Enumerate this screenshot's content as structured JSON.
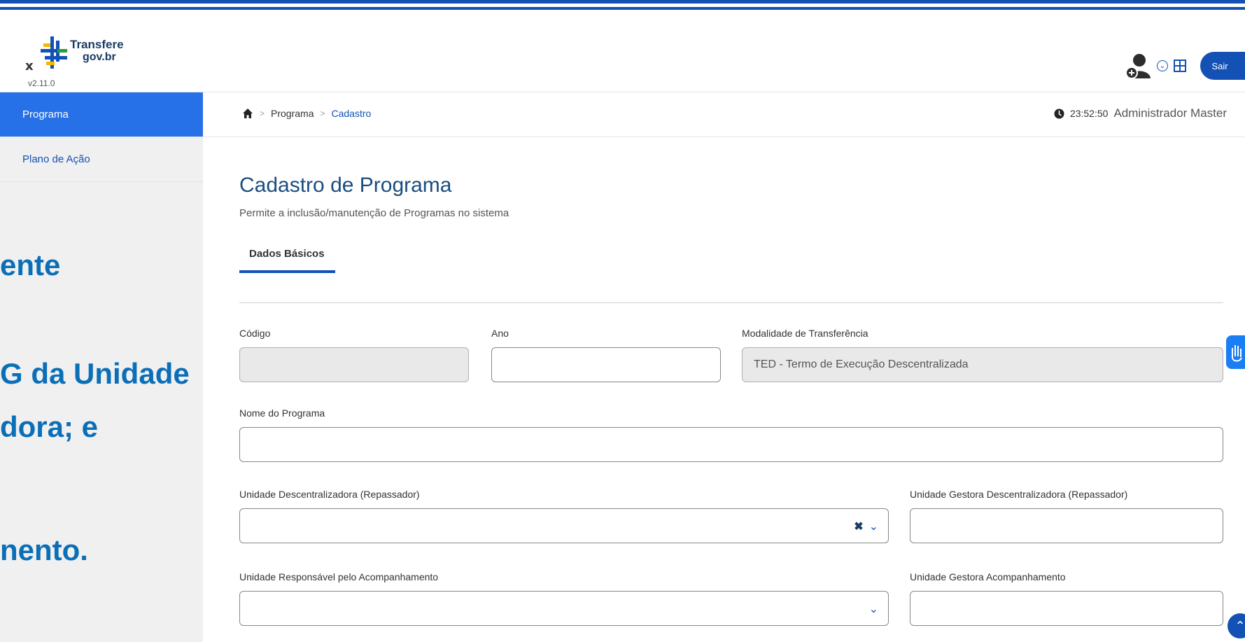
{
  "header": {
    "close_label": "x",
    "logo_line1": "Transfere",
    "logo_line2": "gov.br",
    "version": "v2.11.0",
    "sair_label": "Sair"
  },
  "sidebar": {
    "items": [
      {
        "label": "Programa"
      },
      {
        "label": "Plano de Ação"
      }
    ]
  },
  "breadcrumb": {
    "items": [
      "Programa",
      "Cadastro"
    ],
    "time": "23:52:50",
    "user": "Administrador Master"
  },
  "page": {
    "title": "Cadastro de Programa",
    "subtitle": "Permite a inclusão/manutenção de Programas no sistema",
    "tab": "Dados Básicos"
  },
  "form": {
    "codigo_label": "Código",
    "codigo_value": "",
    "ano_label": "Ano",
    "ano_value": "",
    "modalidade_label": "Modalidade de Transferência",
    "modalidade_value": "TED - Termo de Execução Descentralizada",
    "nome_label": "Nome do Programa",
    "nome_value": "",
    "unidade_desc_label": "Unidade Descentralizadora (Repassador)",
    "unidade_desc_value": "",
    "ug_desc_label": "Unidade Gestora Descentralizadora (Repassador)",
    "ug_desc_value": "",
    "unidade_resp_label": "Unidade Responsável pelo Acompanhamento",
    "unidade_resp_value": "",
    "ug_acomp_label": "Unidade Gestora Acompanhamento",
    "ug_acomp_value": ""
  },
  "overlay": {
    "line1": "ente",
    "line2": "G da Unidade",
    "line3": "dora; e",
    "line4": "nento."
  },
  "colors": {
    "primary": "#1351b4",
    "sidebar_active": "#2670e8",
    "overlay_text": "#0b6fb8"
  }
}
